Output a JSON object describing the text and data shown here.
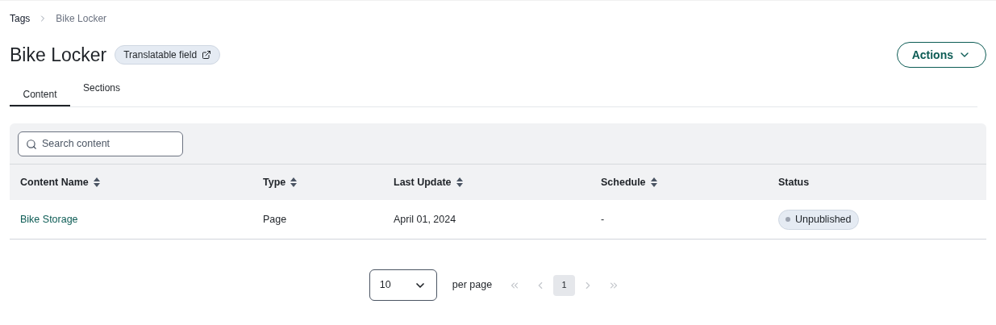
{
  "breadcrumb": [
    {
      "label": "Tags",
      "current": false
    },
    {
      "label": "Bike Locker",
      "current": true
    }
  ],
  "title": "Bike Locker",
  "badge": {
    "label": "Translatable field"
  },
  "actions_button": {
    "label": "Actions"
  },
  "tabs": [
    {
      "label": "Content",
      "selected": true
    },
    {
      "label": "Sections",
      "selected": false
    }
  ],
  "search": {
    "placeholder": "Search content"
  },
  "table": {
    "columns": [
      {
        "label": "Content Name",
        "sortable": true
      },
      {
        "label": "Type",
        "sortable": true
      },
      {
        "label": "Last Update",
        "sortable": true
      },
      {
        "label": "Schedule",
        "sortable": true
      },
      {
        "label": "Status",
        "sortable": false
      }
    ],
    "rows": [
      {
        "name": "Bike Storage",
        "type": "Page",
        "last_update": "April 01, 2024",
        "schedule": "-",
        "status": "Unpublished"
      }
    ]
  },
  "pagination": {
    "page_size": "10",
    "per_page_label": "per page",
    "pages": [
      {
        "label": "1",
        "selected": true
      }
    ],
    "first_disabled": true,
    "prev_disabled": true,
    "next_disabled": true,
    "last_disabled": true
  }
}
